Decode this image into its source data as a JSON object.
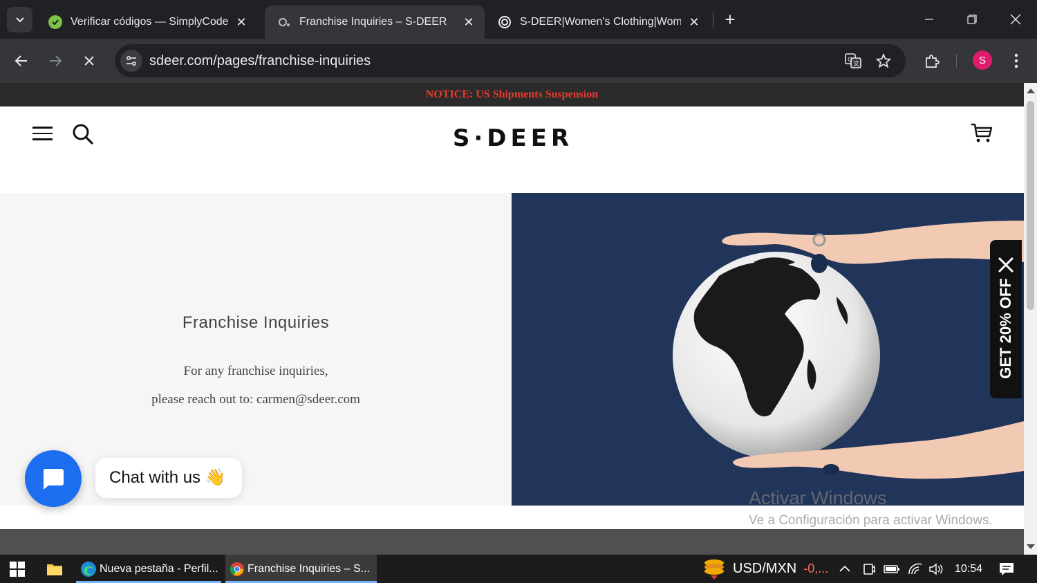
{
  "browser": {
    "tabs": [
      {
        "title": "Verificar códigos — SimplyCode",
        "active": false
      },
      {
        "title": "Franchise Inquiries – S-DEER",
        "active": true
      },
      {
        "title": "S-DEER|Women's Clothing|Women",
        "active": false
      }
    ],
    "url": "sdeer.com/pages/franchise-inquiries",
    "profile_initial": "S"
  },
  "page": {
    "notice": "NOTICE: US Shipments Suspension",
    "logo": "S·DEER",
    "heading": "Franchise Inquiries",
    "body_line1": "For any franchise inquiries,",
    "body_line2": "please reach out to: carmen@sdeer.com",
    "chat_label": "Chat with us",
    "chat_emoji": "👋",
    "promo": "GET 20% OFF",
    "activate_title": "Activar Windows",
    "activate_sub": "Ve a Configuración para activar Windows."
  },
  "taskbar": {
    "apps": [
      {
        "label": "Nueva pestaña - Perfil..."
      },
      {
        "label": "Franchise Inquiries – S..."
      }
    ],
    "currency": "USD/MXN",
    "currency_change": "-0,...",
    "time": "10:54"
  },
  "colors": {
    "notice_text": "#e63b2e",
    "chat_blue": "#1d6df0",
    "globe_bg": "#21345a",
    "profile": "#e01b6c"
  }
}
